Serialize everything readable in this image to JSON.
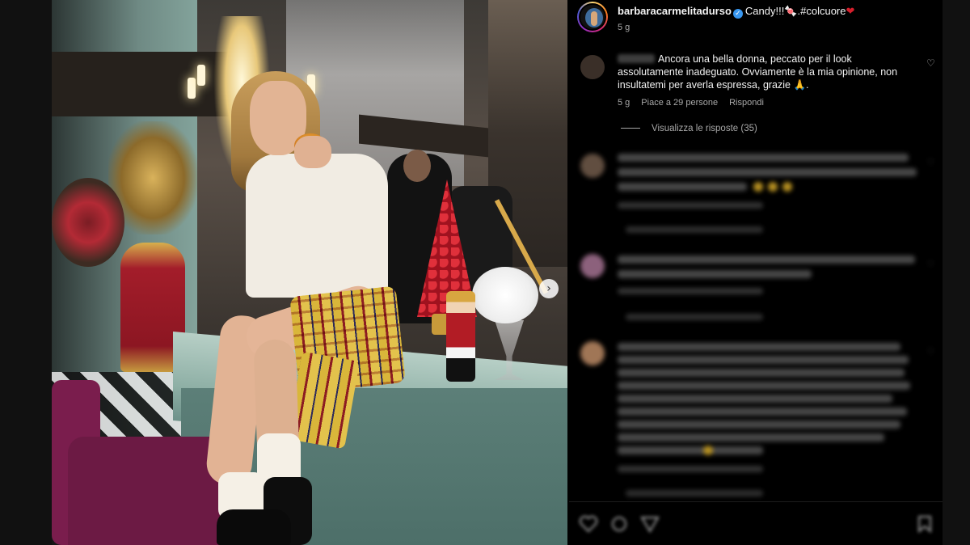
{
  "post": {
    "username": "barbaracarmelitadurso",
    "verified_mark": "✓",
    "caption": "Candy!!!🍬.#colcuore",
    "caption_heart": "❤",
    "time": "5 g"
  },
  "comment_main": {
    "text": "Ancora una bella donna, peccato per il look assolutamente inadeguato. Ovviamente è la mia opinione, non insultatemi per averla espressa, grazie 🙏.",
    "time": "5 g",
    "likes": "Piace a 29 persone",
    "reply": "Rispondi",
    "view_replies": "Visualizza le risposte (35)",
    "like_icon": "heart-outline-icon"
  },
  "blurred_comments": [
    {
      "lines": 3,
      "avatar_color": "#7a6250"
    },
    {
      "lines": 2,
      "avatar_color": "#b07a9c"
    },
    {
      "lines": 9,
      "avatar_color": "#c9946c"
    }
  ],
  "carousel": {
    "next_glyph": "›"
  },
  "actions": [
    "heart-icon",
    "comment-icon",
    "share-icon",
    "bookmark-icon"
  ],
  "colors": {
    "background": "#000000",
    "verified": "#3897f0",
    "heart": "#d61f2c"
  }
}
